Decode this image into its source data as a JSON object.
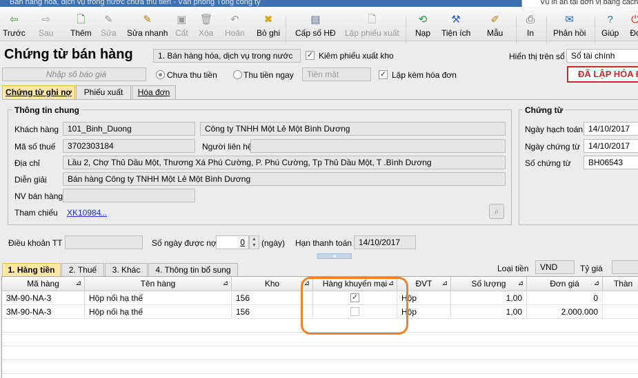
{
  "window": {
    "title": "Bán hàng hóa, dịch vụ trong nước chưa thu tiền - Văn phòng Tổng công ty"
  },
  "tooltip": "Vụ in ấn tại đơn vị bằng cách",
  "toolbar": [
    {
      "label": "Trước",
      "icon": "arrow-left-icon",
      "glyph": "⇦",
      "color": "#3a9a2c"
    },
    {
      "label": "Sau",
      "icon": "arrow-right-icon",
      "glyph": "⇨",
      "color": "#9a9a9a"
    },
    {
      "label": "Thêm",
      "icon": "add-document-icon",
      "glyph": "🗋",
      "color": "#3a7d2c"
    },
    {
      "label": "Sửa",
      "icon": "edit-icon",
      "glyph": "✎",
      "color": "#9a9a9a"
    },
    {
      "label": "Sửa nhanh",
      "icon": "quick-edit-icon",
      "glyph": "✎",
      "color": "#c57a00"
    },
    {
      "label": "Cất",
      "icon": "save-icon",
      "glyph": "▣",
      "color": "#9a9a9a"
    },
    {
      "label": "Xóa",
      "icon": "delete-icon",
      "glyph": "🗑",
      "color": "#9a9a9a"
    },
    {
      "label": "Hoãn",
      "icon": "undo-icon",
      "glyph": "↶",
      "color": "#9a9a9a"
    },
    {
      "label": "Bỏ ghi",
      "icon": "unpost-icon",
      "glyph": "✖",
      "color": "#d9a400"
    },
    {
      "label": "Cấp số HĐ",
      "icon": "invoice-number-icon",
      "glyph": "▤",
      "color": "#5b6b8a"
    },
    {
      "label": "Lập phiếu xuất",
      "icon": "export-slip-icon",
      "glyph": "🗋",
      "color": "#9a9a9a"
    },
    {
      "label": "Nạp",
      "icon": "reload-icon",
      "glyph": "⟲",
      "color": "#1f9a3a"
    },
    {
      "label": "Tiện ích",
      "icon": "utilities-icon",
      "glyph": "⚒",
      "color": "#2f6bb5"
    },
    {
      "label": "Mẫu",
      "icon": "template-icon",
      "glyph": "✐",
      "color": "#c57a00"
    },
    {
      "label": "In",
      "icon": "printer-icon",
      "glyph": "⎙",
      "color": "#555"
    },
    {
      "label": "Phản hồi",
      "icon": "feedback-icon",
      "glyph": "✉",
      "color": "#2f6bb5"
    },
    {
      "label": "Giúp",
      "icon": "help-icon",
      "glyph": "?",
      "color": "#2f6bb5"
    },
    {
      "label": "Đó",
      "icon": "close-icon",
      "glyph": "⏻",
      "color": "#c62828"
    }
  ],
  "header": {
    "title": "Chứng từ bán hàng",
    "type_select": "1. Bán hàng hóa, dịch vụ trong nước",
    "kiem_phieu_xuat_kho": "Kiêm phiếu xuất kho",
    "hien_thi_label": "Hiển thị trên sổ",
    "hien_thi_value": "Sổ tài chính",
    "quote_placeholder": "Nhập số báo giá",
    "chua_thu_tien": "Chưa thu tiền",
    "thu_tien_ngay": "Thu tiền ngay",
    "tien_mat": "Tiền mặt",
    "lap_kem_hoa_don": "Lập kèm hóa đơn",
    "status_banner": "ĐÃ LẬP HÓA Đ"
  },
  "tabs_top": [
    "Chứng từ ghi nợ",
    "Phiếu xuất",
    "Hóa đơn"
  ],
  "general": {
    "group_title": "Thông tin chung",
    "khach_hang_label": "Khách hàng",
    "khach_hang_code": "101_Binh_Duong",
    "khach_hang_name": "Công ty TNHH Một Lẻ Một Bình Dương",
    "ma_so_thue_label": "Mã số thuế",
    "ma_so_thue": "3702303184",
    "nguoi_lien_he_label": "Người liên hệ",
    "dia_chi_label": "Địa chỉ",
    "dia_chi": "Lầu 2, Chợ Thủ Dầu Một, Thương Xá Phú Cường, P. Phú Cường, Tp Thủ Dầu Một, T .Bình Dương",
    "dien_giai_label": "Diễn giải",
    "dien_giai": "Bán hàng Công ty TNHH Một Lẻ Một Bình Dương",
    "nv_ban_hang_label": "NV bán hàng",
    "tham_chieu_label": "Tham chiếu",
    "tham_chieu": "XK10984",
    "tham_chieu_more": "..."
  },
  "voucher": {
    "group_title": "Chứng từ",
    "ngay_hach_toan_label": "Ngày hạch toán",
    "ngay_hach_toan": "14/10/2017",
    "ngay_chung_tu_label": "Ngày chứng từ",
    "ngay_chung_tu": "14/10/2017",
    "so_chung_tu_label": "Số chứng từ",
    "so_chung_tu": "BH06543"
  },
  "terms": {
    "dieu_khoan_label": "Điều khoản TT",
    "so_ngay_label": "Số ngày được nợ",
    "so_ngay": "0",
    "ngay_unit": "(ngày)",
    "han_thanh_toan_label": "Hạn thanh toán",
    "han_thanh_toan": "14/10/2017"
  },
  "tabs_bottom": [
    "1. Hàng tiền",
    "2. Thuế",
    "3. Khác",
    "4. Thông tin bổ sung"
  ],
  "currency": {
    "loai_tien_label": "Loại tiền",
    "loai_tien": "VND",
    "ty_gia_label": "Tỷ giá"
  },
  "grid": {
    "columns": [
      "Mã hàng",
      "Tên hàng",
      "Kho",
      "Hàng khuyến mại",
      "ĐVT",
      "Số lượng",
      "Đơn giá",
      "Thàn"
    ],
    "rows": [
      {
        "ma_hang": "3M-90-NA-3",
        "ten_hang": "Hộp nối hạ thế",
        "kho": "156",
        "khuyen_mai": true,
        "dvt": "Hộp",
        "so_luong": "1,00",
        "don_gia": "0"
      },
      {
        "ma_hang": "3M-90-NA-3",
        "ten_hang": "Hộp nối hạ thế",
        "kho": "156",
        "khuyen_mai": false,
        "dvt": "Hộp",
        "so_luong": "1,00",
        "don_gia": "2.000.000"
      }
    ]
  },
  "colors": {
    "accent_tab": "#ffe7a6",
    "banner": "#c62828",
    "highlight": "#f0802a",
    "link": "#1a33c8"
  }
}
